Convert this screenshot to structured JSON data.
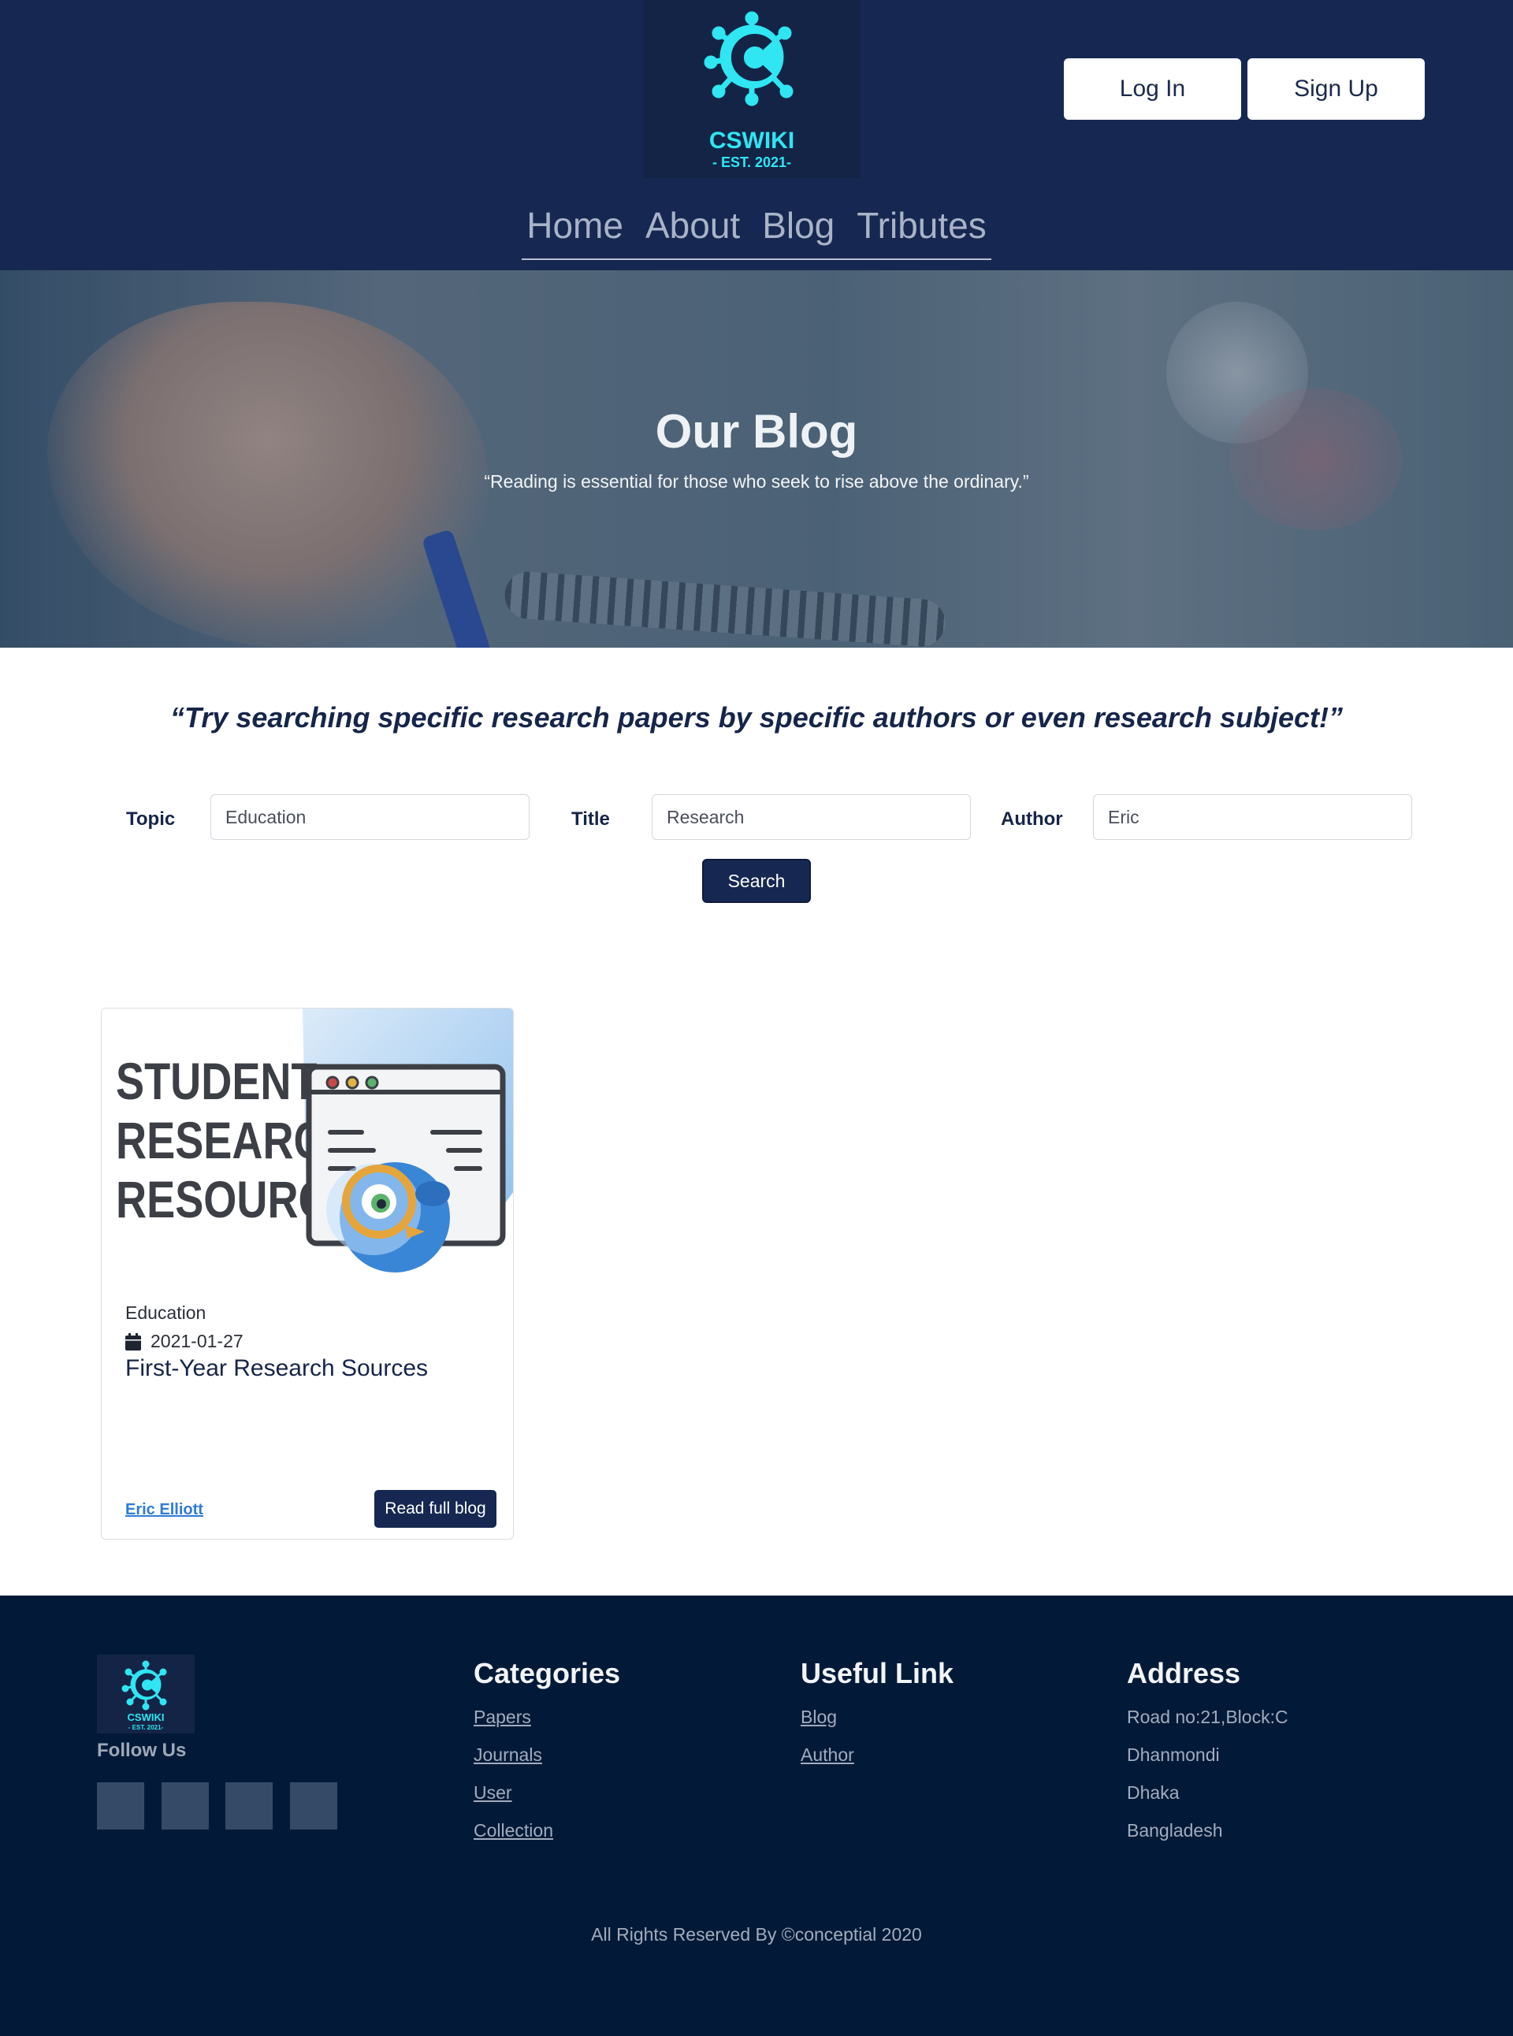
{
  "header": {
    "logo_text": "CSWIKI",
    "logo_sub": "- EST. 2021-",
    "login_label": "Log In",
    "signup_label": "Sign Up",
    "nav": [
      "Home",
      "About",
      "Blog",
      "Tributes"
    ]
  },
  "hero": {
    "title": "Our Blog",
    "quote": "“Reading is essential for those who seek to rise above the ordinary.”"
  },
  "search": {
    "quote": "“Try searching specific research papers by specific authors or even research subject!”",
    "topic_label": "Topic",
    "topic_value": "Education",
    "title_label": "Title",
    "title_value": "Research",
    "author_label": "Author",
    "author_value": "Eric",
    "button_label": "Search"
  },
  "card": {
    "image_text": [
      "STUDENT",
      "RESEARCH",
      "RESOURCES"
    ],
    "category": "Education",
    "date": "2021-01-27",
    "title": "First-Year Research Sources",
    "author": "Eric Elliott",
    "button_label": "Read full blog"
  },
  "footer": {
    "follow_label": "Follow Us",
    "categories_heading": "Categories",
    "categories": [
      "Papers",
      "Journals",
      "User",
      "Collection"
    ],
    "useful_heading": "Useful Link",
    "useful": [
      "Blog",
      "Author"
    ],
    "address_heading": "Address",
    "address": [
      "Road no:21,Block:C",
      "Dhanmondi",
      "Dhaka",
      "Bangladesh"
    ],
    "copyright": "All Rights Reserved By ©conceptial 2020"
  },
  "colors": {
    "header_bg": "#162851",
    "logo_cyan": "#2fe6f2",
    "footer_bg": "#021a38",
    "author_link": "#2f7ad8"
  },
  "icons": [
    "virus-c-logo-icon",
    "calendar-icon",
    "magnifier-bird-icon",
    "social-icon"
  ]
}
